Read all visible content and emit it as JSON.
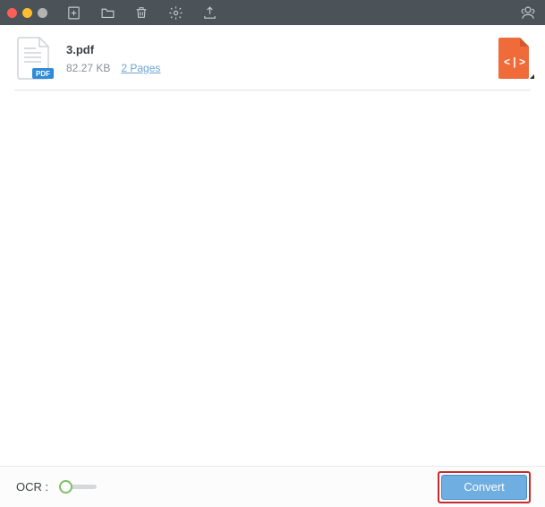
{
  "toolbar": {
    "icons": {
      "add": "add-file-icon",
      "folder": "folder-icon",
      "trash": "trash-icon",
      "settings": "gear-icon",
      "export": "export-icon",
      "support": "support-icon"
    }
  },
  "files": [
    {
      "name": "3.pdf",
      "size": "82.27 KB",
      "pages": "2 Pages",
      "badge": "PDF",
      "output_format": "html"
    }
  ],
  "bottom": {
    "ocr_label": "OCR :",
    "ocr_on": false,
    "convert_label": "Convert"
  },
  "colors": {
    "accent_orange": "#ef6b3a",
    "accent_blue": "#6faee0",
    "badge_blue": "#2f8bd8",
    "highlight_red": "#c72b2b"
  }
}
